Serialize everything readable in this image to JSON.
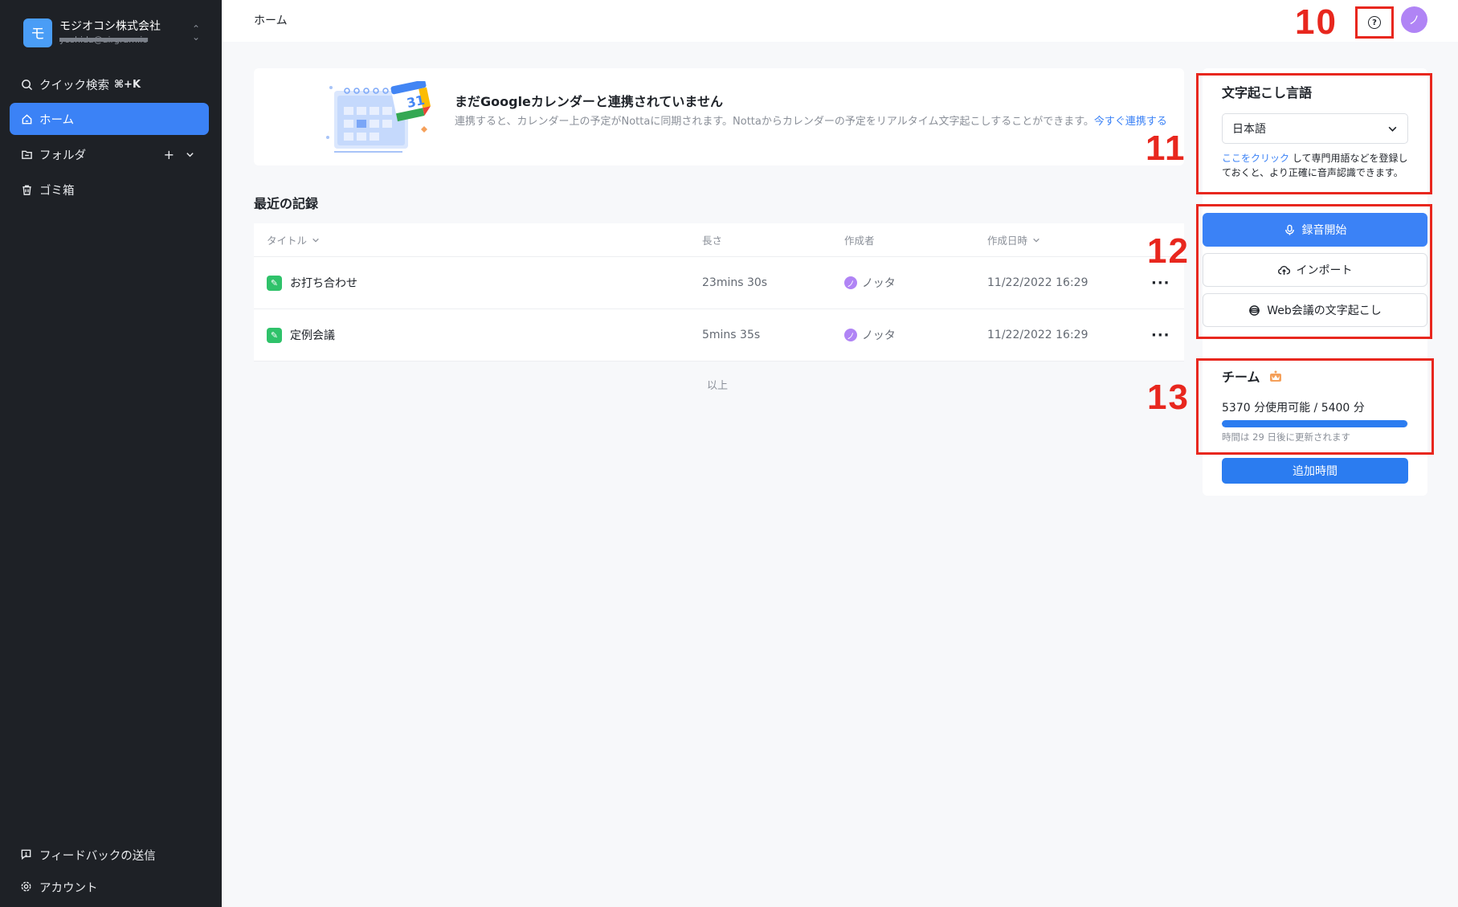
{
  "sidebar": {
    "workspace_initial": "モ",
    "workspace_name": "モジオコシ株式会社",
    "workspace_email": "yoshida@airgram.io",
    "search_label": "クイック検索",
    "search_shortcut": "⌘+K",
    "nav": [
      {
        "label": "ホーム",
        "icon": "home-icon",
        "active": true
      },
      {
        "label": "フォルダ",
        "icon": "folder-icon",
        "active": false
      },
      {
        "label": "ゴミ箱",
        "icon": "trash-icon",
        "active": false
      }
    ],
    "feedback_label": "フィードバックの送信",
    "account_label": "アカウント"
  },
  "header": {
    "breadcrumb": "ホーム",
    "avatar_initial": "ノ"
  },
  "annotations": {
    "a10": "10",
    "a11": "11",
    "a12": "12",
    "a13": "13"
  },
  "calendar_banner": {
    "title": "まだGoogleカレンダーと連携されていません",
    "description": "連携すると、カレンダー上の予定がNottaに同期されます。Nottaからカレンダーの予定をリアルタイム文字起こしすることができます。",
    "link": "今すぐ連携する",
    "calendar_day": "31"
  },
  "records": {
    "section_title": "最近の記録",
    "columns": {
      "title": "タイトル",
      "length": "長さ",
      "author": "作成者",
      "date": "作成日時"
    },
    "rows": [
      {
        "title": "お打ち合わせ",
        "length": "23mins 30s",
        "author": "ノッタ",
        "author_initial": "ノ",
        "date": "11/22/2022 16:29"
      },
      {
        "title": "定例会議",
        "length": "5mins 35s",
        "author": "ノッタ",
        "author_initial": "ノ",
        "date": "11/22/2022 16:29"
      }
    ],
    "end_label": "以上"
  },
  "transcription": {
    "title": "文字起こし言語",
    "selected_language": "日本語",
    "hint_link": "ここをクリック",
    "hint_text": "して専門用語などを登録しておくと、より正確に音声認識できます。"
  },
  "actions": {
    "record": "録音開始",
    "import": "インポート",
    "web_meeting": "Web会議の文字起こし"
  },
  "team": {
    "title": "チーム",
    "usage_text": "5370 分使用可能 / 5400 分",
    "usage_fraction": 0.994,
    "reset_note": "時間は 29 日後に更新されます",
    "add_time": "追加時間"
  },
  "colors": {
    "accent": "#3b82f6",
    "sidebar_bg": "#1e2126",
    "annotation_red": "#e8271e"
  }
}
